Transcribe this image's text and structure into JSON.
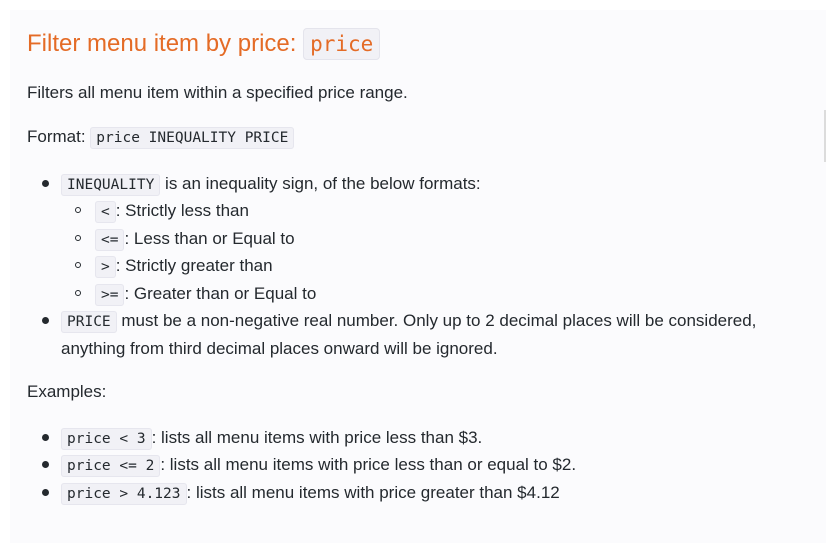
{
  "heading": {
    "text": "Filter menu item by price: ",
    "code": "price"
  },
  "description": "Filters all menu item within a specified price range.",
  "format": {
    "label": "Format: ",
    "code": "price INEQUALITY PRICE"
  },
  "params": [
    {
      "code": "INEQUALITY",
      "text": " is an inequality sign, of the below formats:",
      "sub_items": [
        {
          "code": "<",
          "text": ": Strictly less than"
        },
        {
          "code": "<=",
          "text": ": Less than or Equal to"
        },
        {
          "code": ">",
          "text": ": Strictly greater than"
        },
        {
          "code": ">=",
          "text": ": Greater than or Equal to"
        }
      ]
    },
    {
      "code": "PRICE",
      "text": " must be a non-negative real number. Only up to 2 decimal places will be considered,",
      "text_cont": "anything from third decimal places onward will be ignored."
    }
  ],
  "examples_label": "Examples:",
  "examples": [
    {
      "code": "price < 3",
      "text": ": lists all menu items with price less than $3."
    },
    {
      "code": "price <= 2",
      "text": ": lists all menu items with price less than or equal to $2."
    },
    {
      "code": "price > 4.123",
      "text": ": lists all menu items with price greater than $4.12"
    }
  ]
}
